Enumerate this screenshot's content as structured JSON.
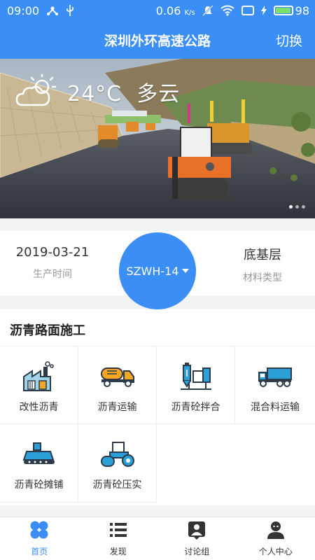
{
  "status_bar": {
    "time": "09:00",
    "speed": "0.06",
    "speed_unit": "K/s",
    "battery": "98",
    "battery_level": 0.98
  },
  "header": {
    "title": "深圳外环高速公路",
    "switch_label": "切换"
  },
  "banner": {
    "weather_text": "24°C  多云",
    "weather_icon": "partly-cloudy-icon",
    "slides": 3,
    "active_slide": 1
  },
  "info": {
    "production_date": "2019-03-21",
    "production_date_label": "生产时间",
    "station_code": "SZWH-14",
    "material_type": "底基层",
    "material_type_label": "材料类型"
  },
  "section": {
    "title": "沥青路面施工",
    "items": [
      {
        "label": "改性沥青",
        "icon": "factory-icon"
      },
      {
        "label": "沥青运输",
        "icon": "tanker-truck-icon"
      },
      {
        "label": "沥青砼拌合",
        "icon": "mixing-plant-icon"
      },
      {
        "label": "混合料运输",
        "icon": "dump-truck-icon"
      },
      {
        "label": "沥青砼摊铺",
        "icon": "paver-icon"
      },
      {
        "label": "沥青砼压实",
        "icon": "road-roller-icon"
      }
    ]
  },
  "tabs": [
    {
      "label": "首页",
      "icon": "home-grid-icon",
      "active": true
    },
    {
      "label": "发现",
      "icon": "list-icon",
      "active": false
    },
    {
      "label": "讨论组",
      "icon": "chat-group-icon",
      "active": false
    },
    {
      "label": "个人中心",
      "icon": "person-icon",
      "active": false
    }
  ],
  "colors": {
    "primary": "#3a8ef6",
    "icon_orange": "#f5a623",
    "icon_blue": "#2a9fd8",
    "icon_dark": "#2d3a4a"
  }
}
